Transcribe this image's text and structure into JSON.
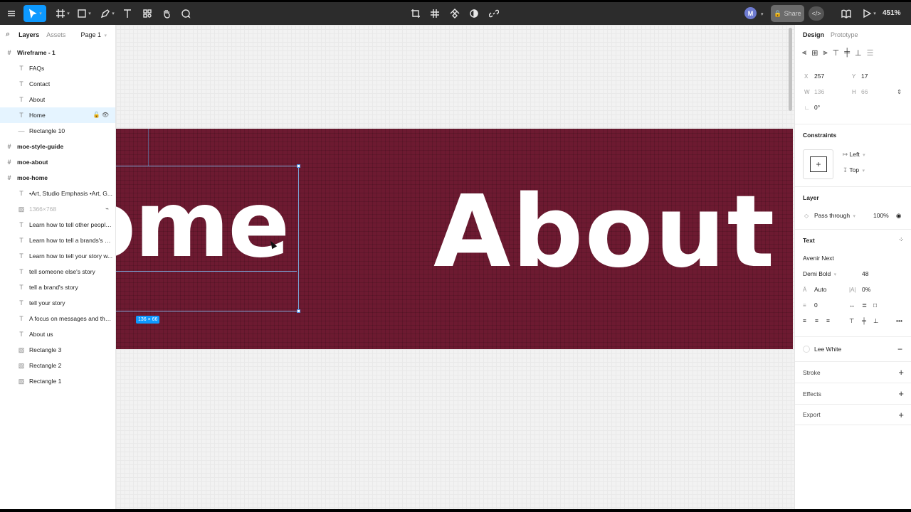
{
  "toolbar": {
    "zoom": "451%",
    "share_label": "Share",
    "avatar_initial": "M",
    "tools": [
      "menu-icon",
      "move-tool-icon",
      "frame-tool-icon",
      "shape-tool-icon",
      "pen-tool-icon",
      "text-tool-icon",
      "resources-icon",
      "hand-tool-icon",
      "comment-tool-icon"
    ],
    "center_tools": [
      "crop-icon",
      "grid-icon",
      "component-icon",
      "contrast-icon",
      "link-icon"
    ]
  },
  "left_panel": {
    "tabs": [
      "Layers",
      "Assets"
    ],
    "page": "Page 1",
    "layers": [
      {
        "label": "Wireframe - 1",
        "type": "frame"
      },
      {
        "label": "FAQs",
        "type": "text"
      },
      {
        "label": "Contact",
        "type": "text"
      },
      {
        "label": "About",
        "type": "text"
      },
      {
        "label": "Home",
        "type": "text",
        "selected": true
      },
      {
        "label": "Rectangle 10",
        "type": "line"
      },
      {
        "label": "moe-style-guide",
        "type": "frame"
      },
      {
        "label": "moe-about",
        "type": "frame"
      },
      {
        "label": "moe-home",
        "type": "frame"
      },
      {
        "label": "•Art, Studio Emphasis •Art, G...",
        "type": "text"
      },
      {
        "label": "1366×768",
        "type": "image",
        "dim": true
      },
      {
        "label": "Learn how to tell other people...",
        "type": "text"
      },
      {
        "label": "Learn how to tell a brands's st...",
        "type": "text"
      },
      {
        "label": "Learn how to tell your story w...",
        "type": "text"
      },
      {
        "label": "tell someone else's story",
        "type": "text"
      },
      {
        "label": "tell a brand's story",
        "type": "text"
      },
      {
        "label": "tell your story",
        "type": "text"
      },
      {
        "label": "A focus on messages and thei...",
        "type": "text"
      },
      {
        "label": "About us",
        "type": "text"
      },
      {
        "label": "Rectangle 3",
        "type": "image"
      },
      {
        "label": "Rectangle 2",
        "type": "image"
      },
      {
        "label": "Rectangle 1",
        "type": "image"
      }
    ]
  },
  "canvas": {
    "home_text": "ome",
    "about_text": "About",
    "dimension_badge": "136 × 66"
  },
  "right_panel": {
    "tabs": [
      "Design",
      "Prototype"
    ],
    "x_label": "X",
    "x_value": "257",
    "y_label": "Y",
    "y_value": "17",
    "w_label": "W",
    "w_value": "136",
    "h_label": "H",
    "h_value": "66",
    "rotation": "0°",
    "constraints_title": "Constraints",
    "constraint_h": "Left",
    "constraint_v": "Top",
    "layer_title": "Layer",
    "blend_mode": "Pass through",
    "opacity": "100%",
    "text_title": "Text",
    "font_family": "Avenir Next",
    "font_weight": "Demi Bold",
    "font_size": "48",
    "line_height": "Auto",
    "letter_spacing": "0%",
    "paragraph_spacing": "0",
    "fill_name": "Lee White",
    "stroke_title": "Stroke",
    "effects_title": "Effects",
    "export_title": "Export"
  }
}
